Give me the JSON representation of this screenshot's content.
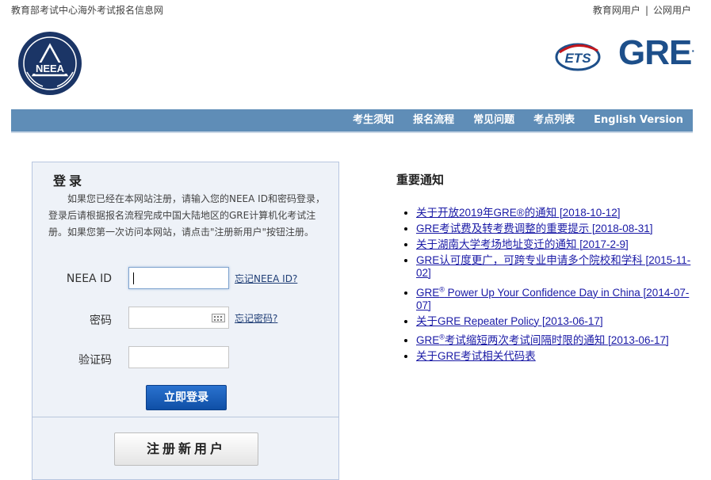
{
  "header": {
    "site_name": "教育部考试中心海外考试报名信息网",
    "links": [
      "教育网用户",
      "公网用户"
    ],
    "separator": "|",
    "neea_logo_text": "NEEA",
    "ets_logo_text": "ETS",
    "gre_logo_text": "GRE",
    "gre_logo_mark": "."
  },
  "nav": {
    "items": [
      "考生须知",
      "报名流程",
      "常见问题",
      "考点列表",
      "English Version"
    ]
  },
  "login": {
    "title": "登录",
    "description": "如果您已经在本网站注册，请输入您的NEEA ID和密码登录，登录后请根据报名流程完成中国大陆地区的GRE计算机化考试注册。如果您第一次访问本网站，请点击\"注册新用户\"按钮注册。",
    "neea_id_label": "NEEA ID",
    "neea_id_value": "",
    "forgot_id": "忘记NEEA ID?",
    "password_label": "密码",
    "password_value": "",
    "forgot_password": "忘记密码?",
    "captcha_label": "验证码",
    "captcha_value": "",
    "login_button": "立即登录",
    "register_button": "注册新用户"
  },
  "notices": {
    "title": "重要通知",
    "items": [
      {
        "text": "关于开放2019年GRE®的通知 [2018-10-12]"
      },
      {
        "text": "GRE考试费及转考费调整的重要提示 [2018-08-31]"
      },
      {
        "text": "关于湖南大学考场地址变迁的通知 [2017-2-9]"
      },
      {
        "text": "GRE认可度更广，可跨专业申请多个院校和学科 [2015-11-02]"
      },
      {
        "pre": "GRE",
        "sup": "®",
        "text": " Power Up Your Confidence Day in China [2014-07-07]"
      },
      {
        "text": "关于GRE Repeater Policy [2013-06-17]"
      },
      {
        "pre": "GRE",
        "sup": "®",
        "text": "考试缩短两次考试间隔时限的通知 [2013-06-17]"
      },
      {
        "text": "关于GRE考试相关代码表"
      }
    ]
  },
  "colors": {
    "nav_bg": "#5f8db7",
    "login_button": "#1a5fbf",
    "brand_blue": "#1d4f8a",
    "ets_red": "#c4161c"
  }
}
